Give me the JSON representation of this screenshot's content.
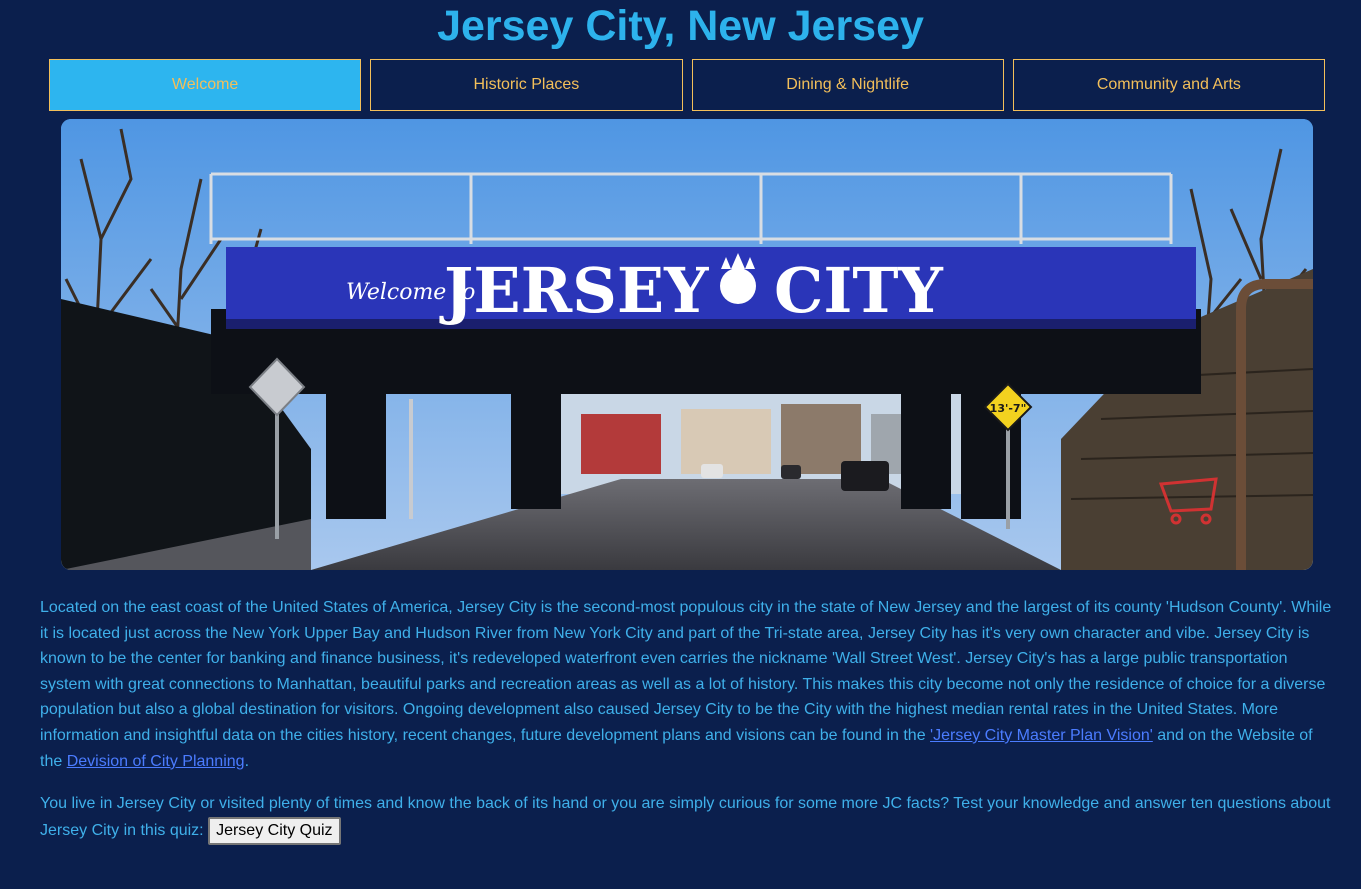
{
  "header": {
    "title": "Jersey City, New Jersey"
  },
  "nav": {
    "tabs": [
      {
        "label": "Welcome",
        "active": true
      },
      {
        "label": "Historic Places",
        "active": false
      },
      {
        "label": "Dining & Nightlife",
        "active": false
      },
      {
        "label": "Community and Arts",
        "active": false
      }
    ]
  },
  "hero": {
    "sign_text_welcome": "Welcome to",
    "sign_text_left": "JERSEY",
    "sign_text_right": "CITY",
    "road_sign": "13'-7\""
  },
  "colors": {
    "background": "#0b1f4d",
    "accent": "#2db5ef",
    "tab_text": "#f3bf5a",
    "link": "#4b7cff"
  },
  "intro": {
    "text_before_link1": "Located on the east coast of the United States of America, Jersey City is the second-most populous city in the state of New Jersey and the largest of its county 'Hudson County'. While it is located just across the New York Upper Bay and Hudson River from New York City and part of the Tri-state area, Jersey City has it's very own character and vibe. Jersey City is known to be the center for banking and finance business, it's redeveloped waterfront even carries the nickname 'Wall Street West'. Jersey City's has a large public transportation system with great connections to Manhattan, beautiful parks and recreation areas as well as a lot of history. This makes this city become not only the residence of choice for a diverse population but also a global destination for visitors. Ongoing development also caused Jersey City to be the City with the highest median rental rates in the United States. More information and insightful data on the cities history, recent changes, future development plans and visions can be found in the ",
    "link1": "'Jersey City Master Plan Vision'",
    "text_between_links": " and on the Website of the ",
    "link2": "Devision of City Planning",
    "text_end": "."
  },
  "quiz": {
    "text": "You live in Jersey City or visited plenty of times and know the back of its hand or you are simply curious for some more JC facts? Test your knowledge and answer ten questions about Jersey City in this quiz: ",
    "button_label": "Jersey City Quiz"
  }
}
